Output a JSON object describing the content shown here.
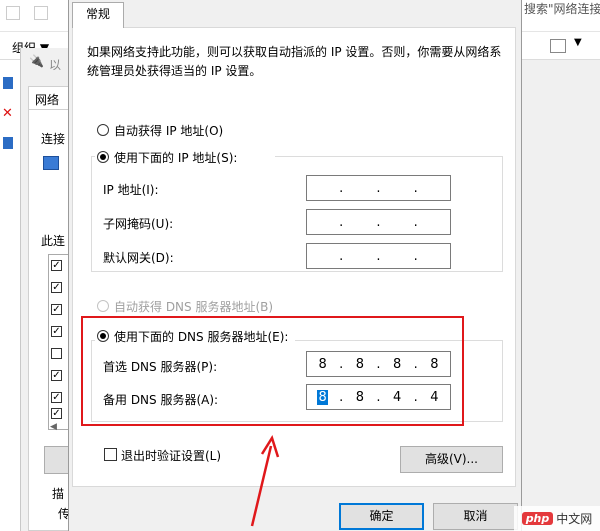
{
  "background": {
    "search_text": "搜索\"网络连接",
    "organize_label": "组织 ▼",
    "props_title_fragment": "以",
    "network_tab": "网络",
    "connect_label": "连接",
    "items_label": "此连",
    "desc_label": "描",
    "desc_fragment": "传"
  },
  "dialog": {
    "tab_general": "常规",
    "description": "如果网络支持此功能，则可以获取自动指派的 IP 设置。否则，你需要从网络系统管理员处获得适当的 IP 设置。",
    "ip_auto_label": "自动获得 IP 地址(O)",
    "ip_manual_label": "使用下面的 IP 地址(S):",
    "ip_address_label": "IP 地址(I):",
    "subnet_label": "子网掩码(U):",
    "gateway_label": "默认网关(D):",
    "dns_auto_label": "自动获得 DNS 服务器地址(B)",
    "dns_manual_label": "使用下面的 DNS 服务器地址(E):",
    "preferred_dns_label": "首选 DNS 服务器(P):",
    "alternate_dns_label": "备用 DNS 服务器(A):",
    "preferred_dns": [
      "8",
      "8",
      "8",
      "8"
    ],
    "alternate_dns": [
      "8",
      "8",
      "4",
      "4"
    ],
    "validate_label": "退出时验证设置(L)",
    "advanced_button": "高级(V)...",
    "ok_button": "确定",
    "cancel_button": "取消"
  },
  "watermark": {
    "badge": "php",
    "site": "中文网"
  },
  "colors": {
    "highlight": "#e0181b",
    "accent": "#0078d7"
  }
}
